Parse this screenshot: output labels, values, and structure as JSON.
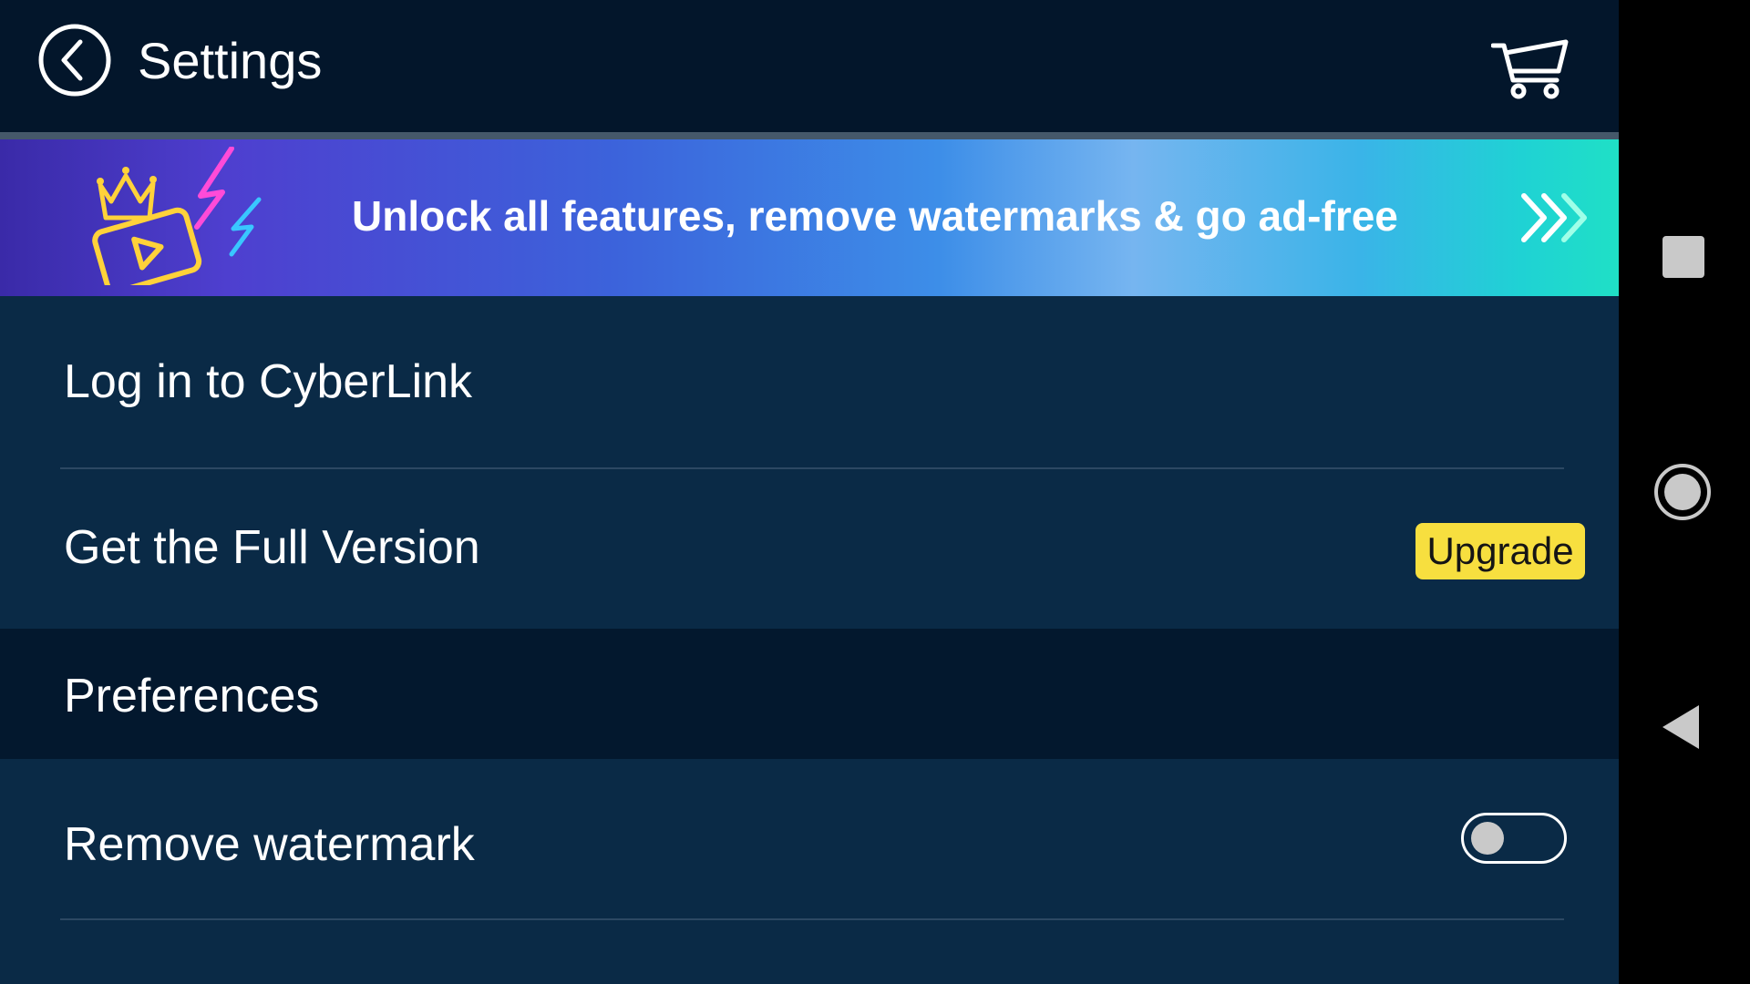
{
  "header": {
    "title": "Settings",
    "back_icon": "back-arrow-circle-icon",
    "cart_icon": "shopping-cart-icon"
  },
  "promo": {
    "text": "Unlock all features, remove watermarks & go ad-free",
    "art_icon": "crown-video-lightning-icon",
    "arrow_icon": "triple-chevron-right-icon"
  },
  "rows": {
    "login": {
      "label": "Log in to CyberLink"
    },
    "full_version": {
      "label": "Get the Full Version",
      "badge": "Upgrade"
    },
    "preferences": {
      "label": "Preferences"
    },
    "watermark": {
      "label": "Remove watermark",
      "toggle_on": false
    }
  },
  "colors": {
    "header_bg": "#03162b",
    "row_bg": "#0a2a46",
    "section_bg": "#03182e",
    "badge_bg": "#f7df3f",
    "separator": "#45586a"
  },
  "system_nav": {
    "recents_icon": "square-recents-icon",
    "home_icon": "circle-home-icon",
    "back_icon": "triangle-back-icon"
  }
}
